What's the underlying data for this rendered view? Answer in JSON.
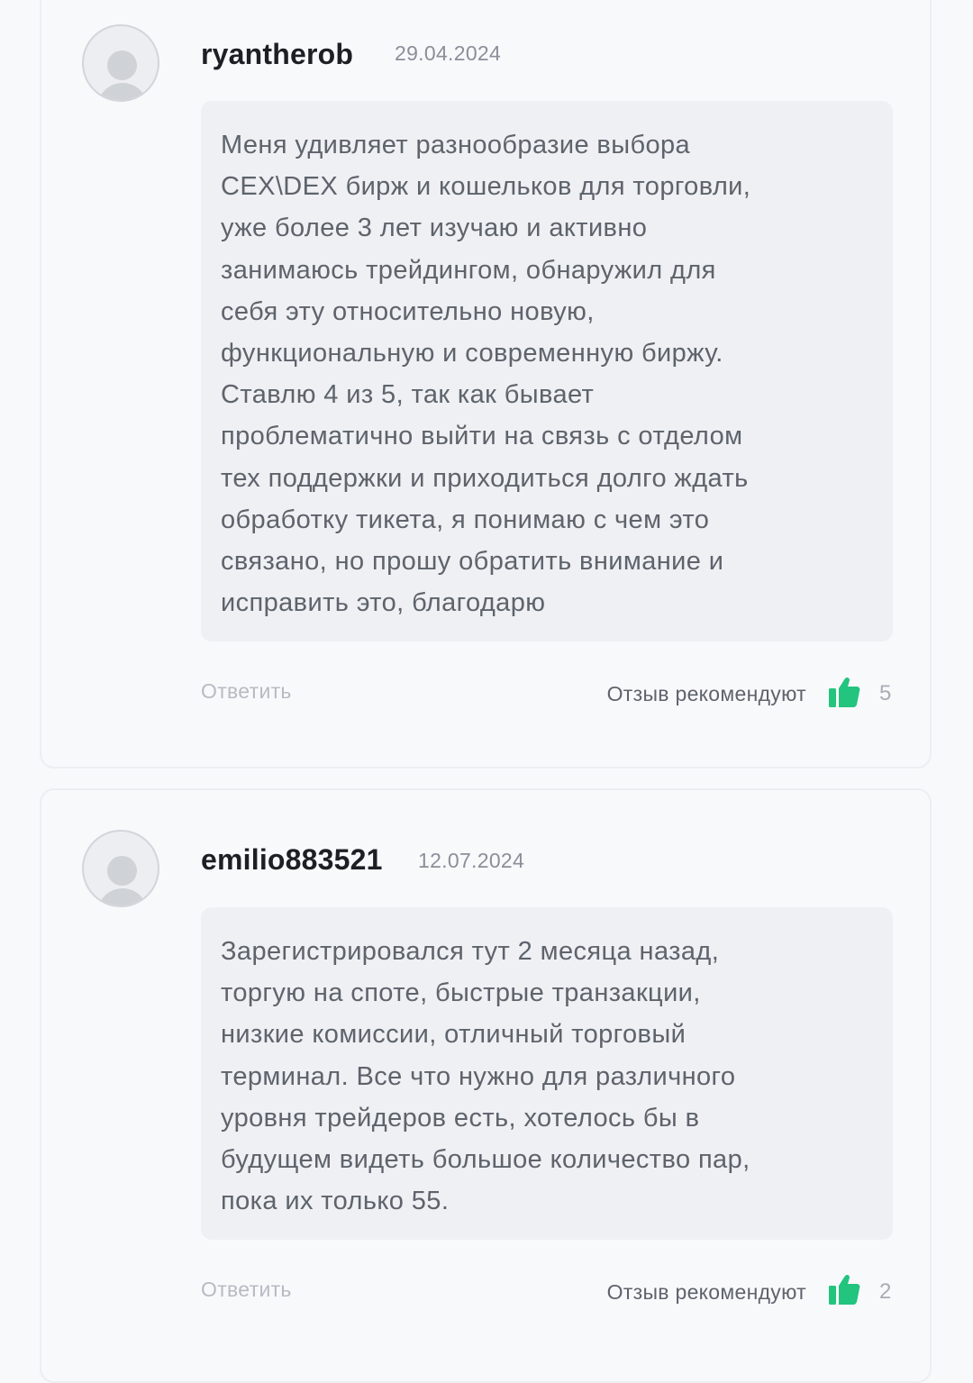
{
  "reviews": [
    {
      "username": "ryantherob",
      "date": "29.04.2024",
      "text": "Меня удивляет разнообразие выбора\nCEX\\DEX бирж и кошельков для торговли,\nуже более 3 лет изучаю и активно\nзанимаюсь трейдингом, обнаружил для\nсебя эту относительно новую,\nфункциональную и современную биржу.\nСтавлю 4 из 5, так как бывает\nпроблематично выйти на связь с отделом\nтех поддержки и приходиться долго ждать\nобработку тикета, я понимаю с чем это\nсвязано, но прошу обратить внимание и\nисправить это, благодарю",
      "reply_label": "Ответить",
      "recommend_label": "Отзыв рекомендуют",
      "recommend_count": "5"
    },
    {
      "username": "emilio883521",
      "date": "12.07.2024",
      "text": "Зарегистрировался тут 2 месяца назад,\nторгую на споте, быстрые транзакции,\nнизкие комиссии, отличный торговый\nтерминал. Все что нужно для различного\nуровня трейдеров есть, хотелось бы в\nбудущем видеть большое количество пар,\nпока их только 55.",
      "reply_label": "Ответить",
      "recommend_label": "Отзыв рекомендуют",
      "recommend_count": "2"
    }
  ],
  "colors": {
    "accent_green": "#22c47e",
    "bubble_bg": "#eef0f3",
    "page_bg": "#f8f9fb"
  },
  "icons": {
    "avatar": "user-placeholder-icon",
    "recommend": "thumbs-up-icon"
  }
}
